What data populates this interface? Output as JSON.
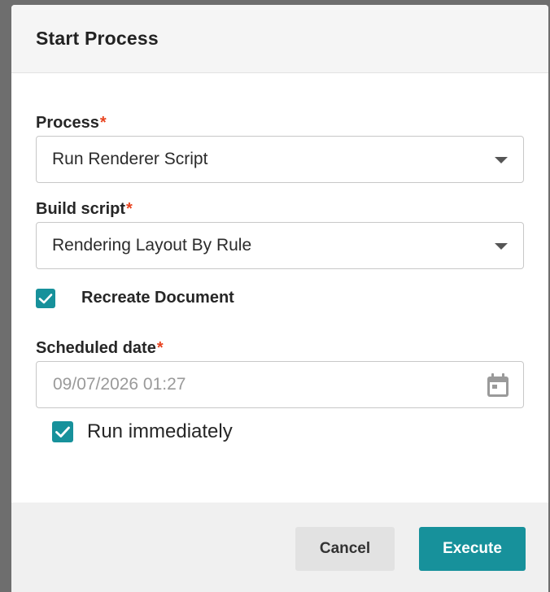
{
  "dialog": {
    "title": "Start Process"
  },
  "form": {
    "process": {
      "label": "Process",
      "required_mark": "*",
      "value": "Run Renderer Script"
    },
    "build_script": {
      "label": "Build script",
      "required_mark": "*",
      "value": "Rendering Layout By Rule"
    },
    "recreate_document": {
      "label": "Recreate Document",
      "checked": true
    },
    "scheduled_date": {
      "label": "Scheduled date",
      "required_mark": "*",
      "value": "09/07/2026 01:27",
      "icon": "calendar-icon"
    },
    "run_immediately": {
      "label": "Run immediately",
      "checked": true
    }
  },
  "footer": {
    "cancel_label": "Cancel",
    "execute_label": "Execute"
  },
  "colors": {
    "accent": "#17919b",
    "required": "#e8431f",
    "header_bg": "#f5f5f5",
    "footer_bg": "#f0f0f0",
    "overlay": "#6e6e6e"
  }
}
